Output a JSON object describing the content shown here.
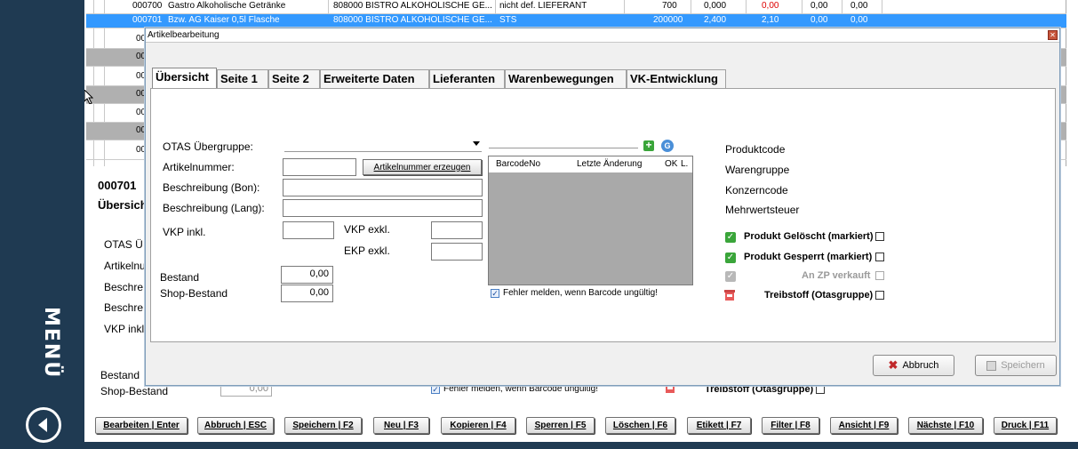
{
  "sidebar": {
    "menu_label": "MENÜ"
  },
  "grid": {
    "rows": [
      {
        "c1": "000700",
        "c2": "Gastro Alkoholische Getränke",
        "c3": "808000 BISTRO ALKOHOLISCHE GE...",
        "c4": "nicht def. LIEFERANT",
        "c5": "700",
        "c6": "0,000",
        "c7": "0,00",
        "c8": "0,00",
        "c9": "0,00"
      },
      {
        "c1": "000701",
        "c2": "Bzw. AG Kaiser 0,5l Flasche",
        "c3": "808000 BISTRO ALKOHOLISCHE GE...",
        "c4": "STS",
        "c5": "200000",
        "c6": "2,400",
        "c7": "2,10",
        "c8": "0,00",
        "c9": "0,00"
      },
      {
        "c1": "00"
      },
      {
        "c1": "00"
      },
      {
        "c1": "00"
      },
      {
        "c1": "00"
      },
      {
        "c1": "00"
      },
      {
        "c1": "00"
      },
      {
        "c1": "00"
      }
    ]
  },
  "background": {
    "article_no": "000701",
    "tab": "Übersicht",
    "otas": "OTAS Ü",
    "artikelnr": "Artikelnu",
    "beschr1": "Beschre",
    "beschr2": "Beschre",
    "vkp": "VKP inkl",
    "bestand": "Bestand",
    "shop_bestand": "Shop-Bestand",
    "shop_value": "0,00",
    "fehler": "Fehler melden, wenn Barcode ungültig!",
    "treibstoff": "Treibstoff (Otasgruppe)"
  },
  "buttons": [
    "Bearbeiten | Enter",
    "Abbruch | ESC",
    "Speichern | F2",
    "Neu | F3",
    "Kopieren | F4",
    "Sperren | F5",
    "Löschen | F6",
    "Etikett | F7",
    "Filter | F8",
    "Ansicht | F9",
    "Nächste | F10",
    "Druck | F11"
  ],
  "dialog": {
    "title": "Artikelbearbeitung",
    "tabs": [
      "Übersicht",
      "Seite 1",
      "Seite 2",
      "Erweiterte Daten",
      "Lieferanten",
      "Warenbewegungen",
      "VK-Entwicklung"
    ],
    "otas_label": "OTAS Übergruppe:",
    "artikelnr_label": "Artikelnummer:",
    "gen_button": "Artikelnummer erzeugen",
    "beschr_bon": "Beschreibung (Bon):",
    "beschr_lang": "Beschreibung (Lang):",
    "vkp_inkl": "VKP inkl.",
    "vkp_exkl": "VKP exkl.",
    "ekp_exkl": "EKP exkl.",
    "bestand": "Bestand",
    "bestand_value": "0,00",
    "shop_bestand": "Shop-Bestand",
    "shop_value": "0,00",
    "barcode_cols": [
      "BarcodeNo",
      "Letzte Änderung",
      "OK",
      "L."
    ],
    "fehler": "Fehler melden, wenn Barcode ungültig!",
    "produktcode": "Produktcode",
    "warengruppe": "Warengruppe",
    "konzerncode": "Konzerncode",
    "mwst": "Mehrwertsteuer",
    "geloescht": "Produkt Gelöscht (markiert)",
    "gesperrt": "Produkt Gesperrt (markiert)",
    "zp": "An ZP verkauft",
    "treibstoff": "Treibstoff (Otasgruppe)",
    "abbruch": "Abbruch",
    "speichern": "Speichern"
  }
}
